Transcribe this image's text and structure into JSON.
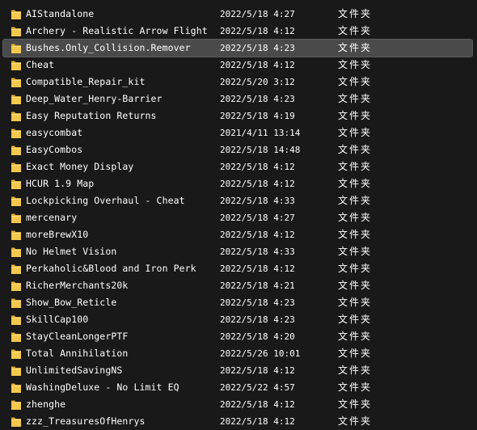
{
  "colors": {
    "background": "#191919",
    "selected_row": "#4a4a4a",
    "folder": "#f4c84d",
    "text": "#ffffff"
  },
  "icon": "folder-icon",
  "selected_index": 2,
  "rows": [
    {
      "name": "AIStandalone",
      "date": "2022/5/18 4:27",
      "type": "文件夹"
    },
    {
      "name": "Archery - Realistic Arrow Flight",
      "date": "2022/5/18 4:12",
      "type": "文件夹"
    },
    {
      "name": "Bushes.Only_Collision.Remover",
      "date": "2022/5/18 4:23",
      "type": "文件夹"
    },
    {
      "name": "Cheat",
      "date": "2022/5/18 4:12",
      "type": "文件夹"
    },
    {
      "name": "Compatible_Repair_kit",
      "date": "2022/5/20 3:12",
      "type": "文件夹"
    },
    {
      "name": "Deep_Water_Henry-Barrier",
      "date": "2022/5/18 4:23",
      "type": "文件夹"
    },
    {
      "name": "Easy Reputation Returns",
      "date": "2022/5/18 4:19",
      "type": "文件夹"
    },
    {
      "name": "easycombat",
      "date": "2021/4/11 13:14",
      "type": "文件夹"
    },
    {
      "name": "EasyCombos",
      "date": "2022/5/18 14:48",
      "type": "文件夹"
    },
    {
      "name": "Exact Money Display",
      "date": "2022/5/18 4:12",
      "type": "文件夹"
    },
    {
      "name": "HCUR 1.9 Map",
      "date": "2022/5/18 4:12",
      "type": "文件夹"
    },
    {
      "name": "Lockpicking Overhaul - Cheat",
      "date": "2022/5/18 4:33",
      "type": "文件夹"
    },
    {
      "name": "mercenary",
      "date": "2022/5/18 4:27",
      "type": "文件夹"
    },
    {
      "name": "moreBrewX10",
      "date": "2022/5/18 4:12",
      "type": "文件夹"
    },
    {
      "name": "No Helmet Vision",
      "date": "2022/5/18 4:33",
      "type": "文件夹"
    },
    {
      "name": "Perkaholic&Blood and Iron Perk",
      "date": "2022/5/18 4:12",
      "type": "文件夹"
    },
    {
      "name": "RicherMerchants20k",
      "date": "2022/5/18 4:21",
      "type": "文件夹"
    },
    {
      "name": "Show_Bow_Reticle",
      "date": "2022/5/18 4:23",
      "type": "文件夹"
    },
    {
      "name": "SkillCap100",
      "date": "2022/5/18 4:23",
      "type": "文件夹"
    },
    {
      "name": "StayCleanLongerPTF",
      "date": "2022/5/18 4:20",
      "type": "文件夹"
    },
    {
      "name": "Total Annihilation",
      "date": "2022/5/26 10:01",
      "type": "文件夹"
    },
    {
      "name": "UnlimitedSavingNS",
      "date": "2022/5/18 4:12",
      "type": "文件夹"
    },
    {
      "name": "WashingDeluxe - No Limit EQ",
      "date": "2022/5/22 4:57",
      "type": "文件夹"
    },
    {
      "name": "zhenghe",
      "date": "2022/5/18 4:12",
      "type": "文件夹"
    },
    {
      "name": "zzz_TreasuresOfHenrys",
      "date": "2022/5/18 4:12",
      "type": "文件夹"
    }
  ]
}
